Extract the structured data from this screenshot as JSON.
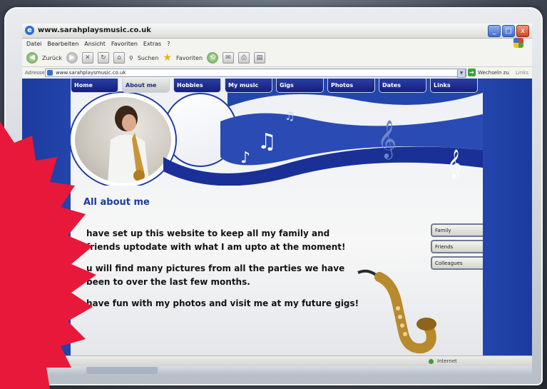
{
  "window": {
    "title": "www.sarahplaysmusic.co.uk",
    "controls": [
      "_",
      "□",
      "x"
    ]
  },
  "menu": [
    "Datei",
    "Bearbeiten",
    "Ansicht",
    "Favoriten",
    "Extras",
    "?"
  ],
  "toolbar": {
    "back_label": "Zurück",
    "search_label": "Suchen",
    "favorites_label": "Favoriten"
  },
  "address": {
    "label": "Adresse",
    "url": "www.sarahplaysmusic.co.uk",
    "go_label": "Wechseln zu",
    "links_label": "Links"
  },
  "site": {
    "nav": [
      "Home",
      "About me",
      "Hobbies",
      "My music",
      "Gigs",
      "Photos",
      "Dates",
      "Links"
    ],
    "active_nav": "About me",
    "heading": "All about me",
    "paragraphs": [
      "have set up this website to keep all my family and friends uptodate with what I am upto at the moment!",
      "u will find many pictures from all the parties we have been to over the last few months.",
      "have fun with my photos and visit me at my future gigs!"
    ],
    "side_menu": [
      "Family",
      "Friends",
      "Colleagues"
    ]
  },
  "status": {
    "zone": "Internet"
  },
  "colors": {
    "site_blue": "#2346ad",
    "nav_dark": "#141f78",
    "burst_red": "#e8183a"
  }
}
